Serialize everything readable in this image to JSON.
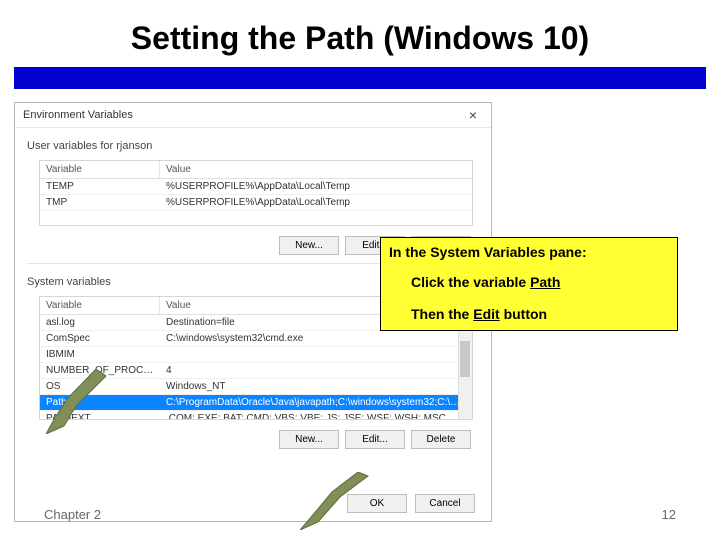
{
  "slide": {
    "title": "Setting the Path (Windows 10)",
    "chapter": "Chapter 2",
    "page": "12"
  },
  "dialog": {
    "title": "Environment Variables",
    "close": "×",
    "user_pane_label": "User variables for rjanson",
    "system_pane_label": "System variables",
    "columns": {
      "var": "Variable",
      "val": "Value"
    },
    "user_rows": [
      {
        "var": "TEMP",
        "val": "%USERPROFILE%\\AppData\\Local\\Temp"
      },
      {
        "var": "TMP",
        "val": "%USERPROFILE%\\AppData\\Local\\Temp"
      }
    ],
    "sys_rows": [
      {
        "var": "asl.log",
        "val": "Destination=file"
      },
      {
        "var": "ComSpec",
        "val": "C:\\windows\\system32\\cmd.exe"
      },
      {
        "var": "IBMIM",
        "val": ""
      },
      {
        "var": "NUMBER_OF_PROCESSORS",
        "val": "4"
      },
      {
        "var": "OS",
        "val": "Windows_NT"
      },
      {
        "var": "Path",
        "val": "C:\\ProgramData\\Oracle\\Java\\javapath;C:\\windows\\system32;C:\\wi...",
        "selected": true
      },
      {
        "var": "PATHEXT",
        "val": ".COM;.EXE;.BAT;.CMD;.VBS;.VBE;.JS;.JSE;.WSF;.WSH;.MSC"
      }
    ],
    "buttons": {
      "new": "New...",
      "edit": "Edit...",
      "delete": "Delete",
      "ok": "OK",
      "cancel": "Cancel"
    }
  },
  "annotation": {
    "title": "In the System Variables pane:",
    "line1_a": "Click the variable ",
    "line1_b": "Path",
    "line2_a": "Then the ",
    "line2_b": "Edit",
    "line2_c": " button"
  }
}
